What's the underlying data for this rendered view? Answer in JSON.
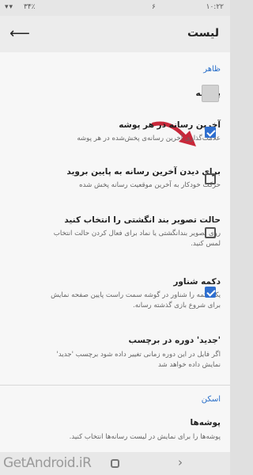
{
  "status_bar": {
    "time": "۱۰:۲۲",
    "battery": "۳۴٪",
    "signal_icons": "▾▾",
    "extra": "۶"
  },
  "app_bar": {
    "title": "لیست",
    "back_icon": "arrow-back-icon"
  },
  "sections": {
    "appearance": "ظاهر",
    "scan": "اسکن"
  },
  "settings": {
    "cover": {
      "title": "پوسته"
    },
    "last_media": {
      "title": "آخرین رسانه در هر پوشه",
      "subtitle": "علامت‌گذاری آخرین رسانه‌ی پخش‌شده در هر پوشه",
      "checked": true
    },
    "scroll_last": {
      "title": "برای دیدن آخرین رسانه به پایین بروید",
      "subtitle": "حرکت خودکار به آخرین موقعیت رسانه پخش شده",
      "checked": false
    },
    "thumb_select": {
      "title": "حالت تصویر بند انگشتی را انتخاب کنید",
      "subtitle": "روی تصویر بندانگشتی یا نماد برای فعال کردن حالت انتخاب لمس کنید.",
      "checked": false
    },
    "float_button": {
      "title": "دکمه شناور",
      "subtitle": "یک دکمه را شناور در گوشه سمت راست پایین صفحه نمایش برای شروع بازی گذشته رسانه.",
      "checked": true
    },
    "new_label": {
      "title": "'جدید' دوره در برچسب",
      "subtitle": "اگر فایل در این دوره زمانی تغییر داده شود برچسب 'جدید' نمایش داده خواهد شد"
    },
    "folders": {
      "title": "پوشه‌ها",
      "subtitle": "پوشه‌ها را برای نمایش در لیست رسانه‌ها انتخاب کنید."
    }
  },
  "watermark": "GetAndroid.iR",
  "nav": {
    "home_icon": "home-icon",
    "forward_icon": "chevron-right-icon"
  },
  "colors": {
    "accent": "#2f6fcf",
    "section": "#2a6fc9",
    "arrow": "#c8283a"
  }
}
